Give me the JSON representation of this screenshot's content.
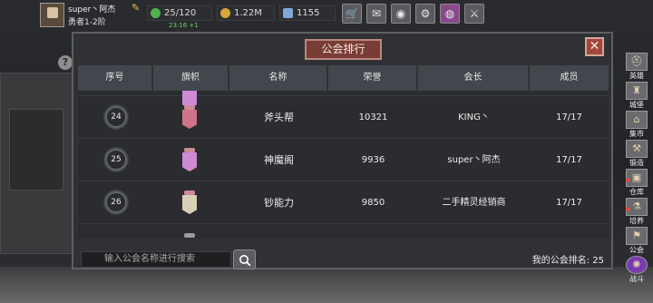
{
  "player": {
    "name": "super丶阿杰",
    "rank": "勇者1-2阶"
  },
  "resources": {
    "stamina": "25/120",
    "stamina_timer": "23:16 +1",
    "gold": "1.22M",
    "gems": "1155"
  },
  "modal": {
    "title": "公会排行",
    "columns": [
      "序号",
      "旗帜",
      "名称",
      "荣誉",
      "会长",
      "成员"
    ],
    "rows": [
      {
        "index": "24",
        "name": "斧头帮",
        "honor": "10321",
        "leader": "KING丶",
        "members": "17/17",
        "flag_color": "#d0748a"
      },
      {
        "index": "25",
        "name": "神魔阁",
        "honor": "9936",
        "leader": "super丶阿杰",
        "members": "17/17",
        "flag_color": "#cf8ad3"
      },
      {
        "index": "26",
        "name": "钞能力",
        "honor": "9850",
        "leader": "二手精灵经销商",
        "members": "17/17",
        "flag_color": "#d9cfb6"
      }
    ],
    "search_placeholder": "输入公会名称进行搜索",
    "my_rank_label": "我的公会排名:",
    "my_rank_value": "25"
  },
  "side_menu": [
    "英雄",
    "城堡",
    "集市",
    "锻造",
    "仓库",
    "培养",
    "公会",
    "战斗"
  ],
  "icons": {
    "top_buttons": [
      "cart-icon",
      "mail-icon",
      "gamepad-icon",
      "settings-icon",
      "color-wheel-icon",
      "sword-icon"
    ]
  }
}
